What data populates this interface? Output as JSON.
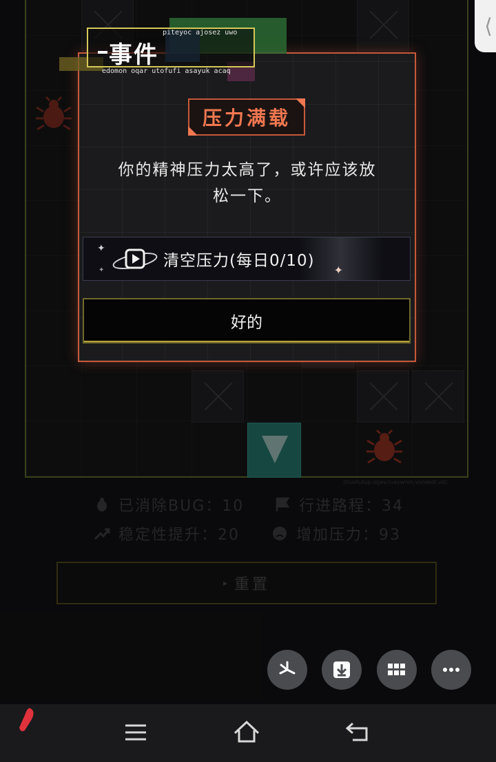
{
  "edge_tab": {
    "glyph": "⟨"
  },
  "event": {
    "tag_title": "事件",
    "tag_subtitle_top": "piteyoc ajosez uwo",
    "tag_subtitle_bottom": "edomon oqar utofufi asayuk acaq"
  },
  "dialog": {
    "heading": "压力满载",
    "message_line1": "你的精神压力太高了，或许应该放",
    "message_line2": "松一下。",
    "clear_stress_button": "清空压力(每日0/10)",
    "ok_button": "好的"
  },
  "board": {
    "caption": "zhuotutup.ogav.ruaywnm.voowidl.vdc"
  },
  "stats": {
    "bugs_cleared": "已消除BUG：10",
    "distance": "行进路程：34",
    "stability": "稳定性提升：20",
    "stress_added": "增加压力：93"
  },
  "reset_button": "重置",
  "fabs": [
    {
      "icon": "pinwheel-icon"
    },
    {
      "icon": "download-icon"
    },
    {
      "icon": "grid-icon"
    },
    {
      "icon": "more-icon"
    }
  ],
  "navbar": {
    "icons": [
      "menu-icon",
      "home-icon",
      "back-icon"
    ]
  },
  "colors": {
    "dialog_border": "#c5593a",
    "heading_text": "#f07750",
    "tag_border": "#d6c95a",
    "teal_tile": "#24756a"
  }
}
